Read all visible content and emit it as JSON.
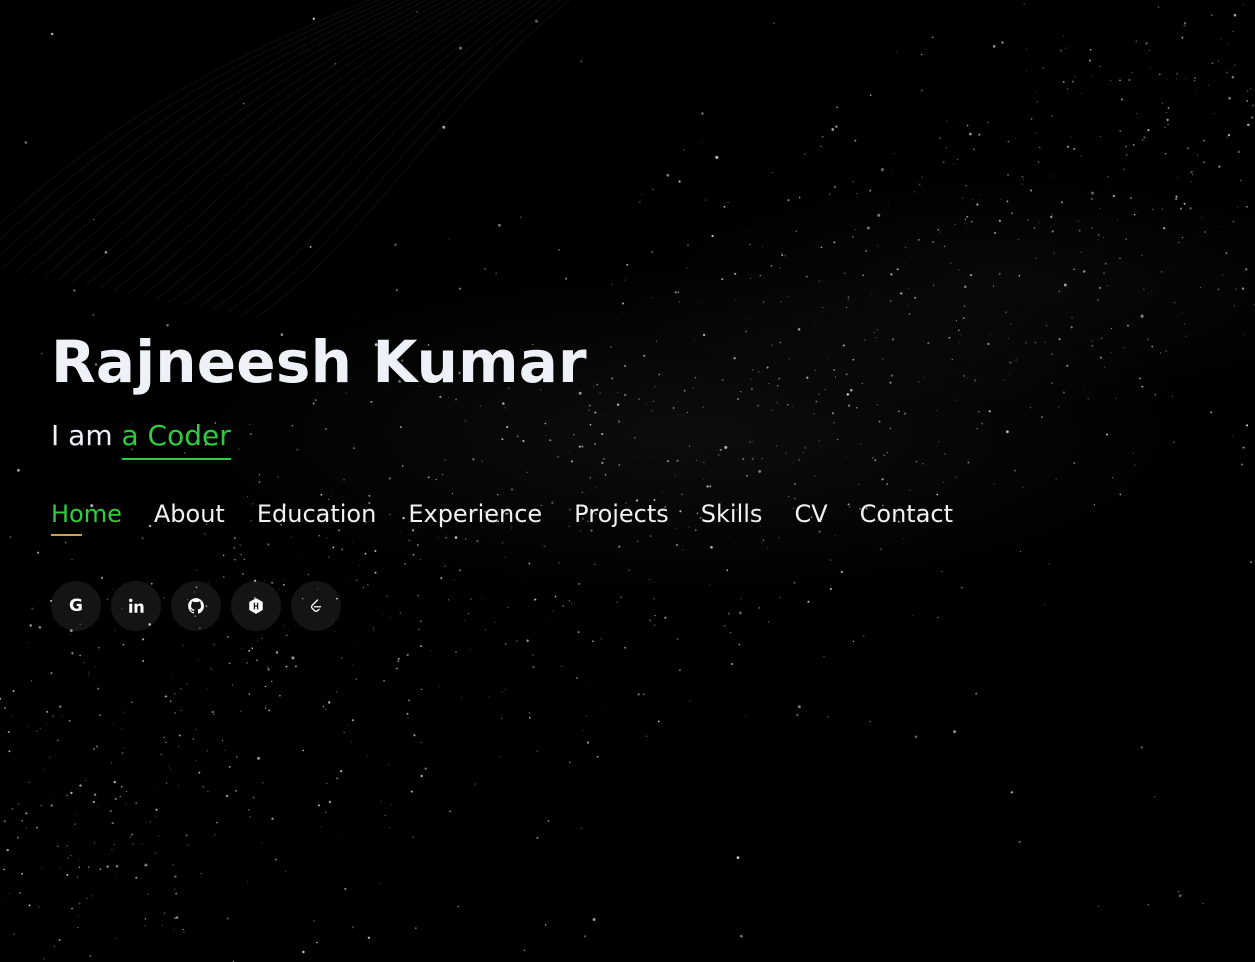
{
  "hero": {
    "name": "Rajneesh Kumar",
    "tagline_prefix": "I am ",
    "tagline_typed": "a Coder"
  },
  "nav": {
    "items": [
      {
        "label": "Home",
        "active": true
      },
      {
        "label": "About"
      },
      {
        "label": "Education"
      },
      {
        "label": "Experience"
      },
      {
        "label": "Projects"
      },
      {
        "label": "Skills"
      },
      {
        "label": "CV"
      },
      {
        "label": "Contact"
      }
    ]
  },
  "socials": [
    {
      "icon": "google-icon"
    },
    {
      "icon": "linkedin-icon"
    },
    {
      "icon": "github-icon"
    },
    {
      "icon": "hackerrank-icon"
    },
    {
      "icon": "leetcode-icon"
    }
  ],
  "colors": {
    "background": "#000000",
    "accent_green": "#2ecc40",
    "active_underline": "#c9a24a",
    "text": "#eef1f7"
  }
}
